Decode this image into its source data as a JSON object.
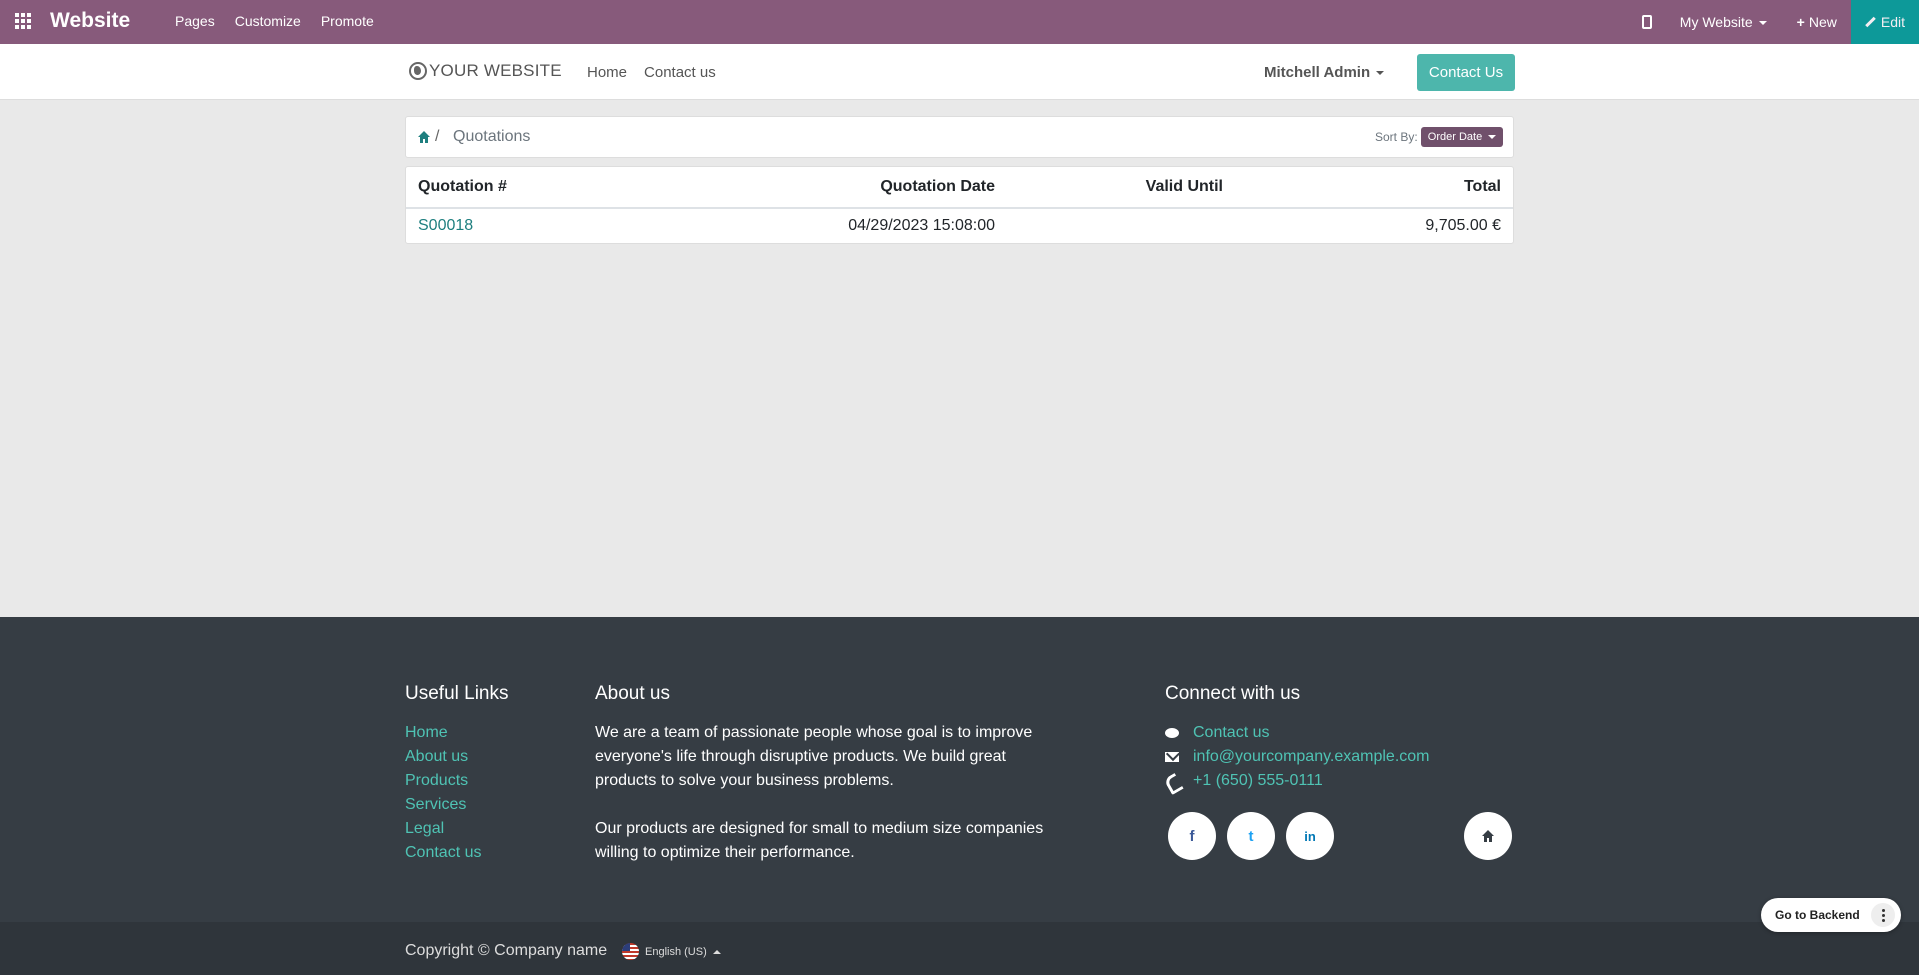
{
  "topbar": {
    "brand": "Website",
    "nav": [
      "Pages",
      "Customize",
      "Promote"
    ],
    "my_website": "My Website",
    "new_label": "New",
    "edit_label": "Edit"
  },
  "site": {
    "logo_text": "YOUR WEBSITE",
    "nav": [
      "Home",
      "Contact us"
    ],
    "user": "Mitchell Admin",
    "contact_button": "Contact Us"
  },
  "breadcrumb": {
    "separator": "/",
    "current": "Quotations",
    "sort_label": "Sort By:",
    "sort_value": "Order Date"
  },
  "table": {
    "headers": [
      "Quotation #",
      "Quotation Date",
      "Valid Until",
      "Total"
    ],
    "rows": [
      {
        "number": "S00018",
        "date": "04/29/2023 15:08:00",
        "valid_until": "",
        "total": "9,705.00 €"
      }
    ]
  },
  "footer": {
    "useful_links_title": "Useful Links",
    "useful_links": [
      "Home",
      "About us",
      "Products",
      "Services",
      "Legal",
      "Contact us"
    ],
    "about_title": "About us",
    "about_p1": "We are a team of passionate people whose goal is to improve everyone's life through disruptive products. We build great products to solve your business problems.",
    "about_p2": "Our products are designed for small to medium size companies willing to optimize their performance.",
    "connect_title": "Connect with us",
    "contact_link": "Contact us",
    "email": "info@yourcompany.example.com",
    "phone": "+1 (650) 555-0111",
    "social": [
      "f",
      "t",
      "in"
    ],
    "copyright": "Copyright © Company name",
    "language": "English (US)"
  },
  "backend": {
    "label": "Go to Backend"
  },
  "colors": {
    "topbar": "#875a7b",
    "accent": "#4db6ac",
    "footer": "#363d44"
  }
}
